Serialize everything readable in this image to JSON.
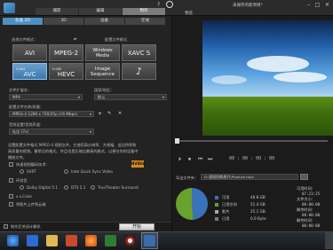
{
  "titlebar": {
    "tabs": [
      "捕获",
      "编辑",
      "制作"
    ],
    "active_tab_index": 2,
    "project_title": "未保存的新项目*",
    "help_glyph": "?",
    "minimize_glyph": "–",
    "maximize_glyph": "□",
    "close_glyph": "✕"
  },
  "subtabs": [
    "标准 2D",
    "3D",
    "设备",
    "在线"
  ],
  "active_subtab_index": 0,
  "format_section": {
    "label": "选择文件格式：",
    "profile_label": "配置文件格式",
    "formats": [
      {
        "label": "AVI",
        "sub": ""
      },
      {
        "label": "MPEG-2",
        "sub": ""
      },
      {
        "label": "Windows Media",
        "sub": ""
      },
      {
        "label": "XAVC S",
        "sub": ""
      },
      {
        "label": "AVC",
        "sub": "H.264"
      },
      {
        "label": "HEVC",
        "sub": "H.265"
      },
      {
        "label": "Image Sequence",
        "sub": ""
      },
      {
        "label": "♪",
        "sub": ""
      }
    ],
    "selected_index": 4
  },
  "options": {
    "file_ext_label": "文件扩展名：",
    "file_ext_value": "MP4",
    "country_label": "国家/地区：",
    "country_value": "默认",
    "profile_name_label": "配置文件名称/质量：",
    "profile_name_value": "MPEG-4 1280 x 720/25p (16 Mbps)",
    "audio_label": "音频设置/音频声道：",
    "audio_value": "杜比 (7x)"
  },
  "info_text": "设置配置文件格式 MPEG-4 视频文件。它使用高分辨率、大帧幅、低比特率和高质量的视频。最常见的格式，并且也是压缩比最高的格式，以便在你的设备中播放文件。",
  "checkboxes": {
    "hw_encode_label": "快速视频编码技术：",
    "svrt_label": "SVRT",
    "intel_label": "Intel Quick Sync Video",
    "surround_label": "环绕音",
    "dolby_label": "Dolby Digital 5.1",
    "dts_label": "DTS 5.1",
    "truetheater_label": "TrueTheater Surround",
    "xvcolor_label": "x.v.Color",
    "upload_label": "将影片上传到云端"
  },
  "hw_badge": "NVIDIA",
  "bottom": {
    "shutdown_label": "制作后关闭计算机",
    "start_label": "开始"
  },
  "preview": {
    "label": "预览"
  },
  "player": {
    "timecode": "00 : 00 : 00 : 00",
    "controls": [
      "⏵",
      "⏹",
      "⏮",
      "⏭"
    ]
  },
  "output": {
    "path_label": "导出文件夹：",
    "path_value": "D:\\视频剪辑\\影片\\Produce.mp4"
  },
  "disk_chart": {
    "legend": [
      {
        "name": "可用",
        "value": "48.8 GB",
        "color": "#3a72b8"
      },
      {
        "name": "已用空间",
        "value": "51.4 GB",
        "color": "#6aa32b"
      },
      {
        "name": "影片",
        "value": "25.1 GB",
        "color": "#a9a9a9"
      },
      {
        "name": "已用",
        "value": "0.0 Byte",
        "color": "#7a7a7a"
      }
    ],
    "fractions": [
      0.486,
      0.514
    ]
  },
  "stats": [
    {
      "label": "可用时间：",
      "value": "07:23:25"
    },
    {
      "label": "文件大小：",
      "value": "00:00:00"
    },
    {
      "label": "剩余时间：",
      "value": "00:00:00"
    },
    {
      "label": "剩余时间：",
      "value": "00:00:00"
    }
  ]
}
